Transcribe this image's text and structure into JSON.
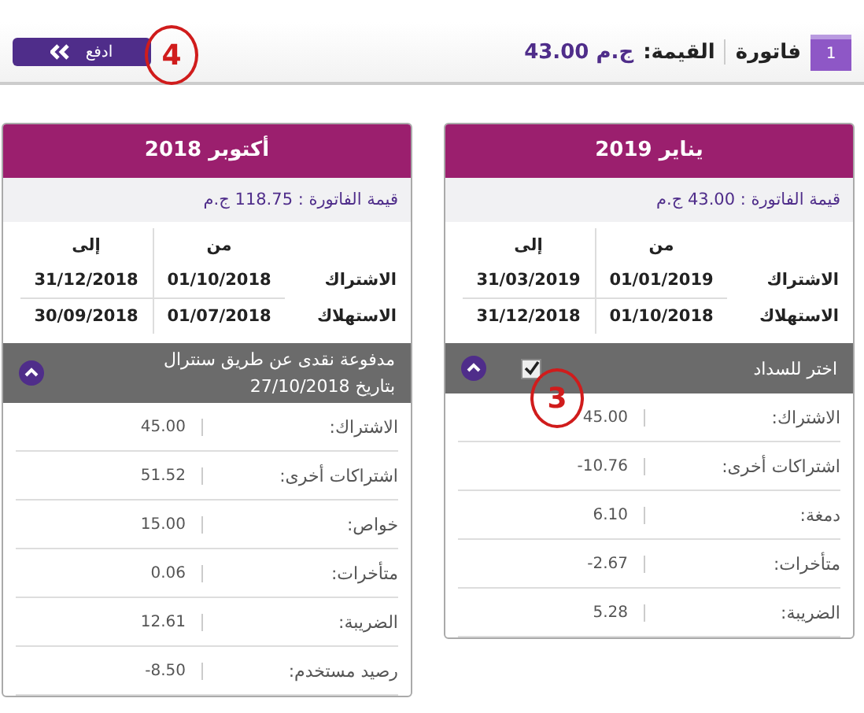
{
  "header": {
    "badge": "1",
    "title": "فاتورة",
    "value_label": "القيمة:",
    "value": "ج.م 43.00",
    "pay_button": "ادفع"
  },
  "cards": [
    {
      "month": "يناير 2019",
      "amount": "قيمة الفاتورة : 43.00 ج.م",
      "period_headers": [
        "من",
        "إلى"
      ],
      "periods": [
        {
          "label": "الاشتراك",
          "from": "01/01/2019",
          "to": "31/03/2019"
        },
        {
          "label": "الاستهلاك",
          "from": "01/10/2018",
          "to": "31/12/2018"
        }
      ],
      "status": {
        "kind": "select",
        "lines": [
          "اختر للسداد"
        ],
        "checked": true
      },
      "items": [
        {
          "label": "الاشتراك:",
          "value": "45.00"
        },
        {
          "label": "اشتراكات أخرى:",
          "value": "-10.76"
        },
        {
          "label": "دمغة:",
          "value": "6.10"
        },
        {
          "label": "متأخرات:",
          "value": "-2.67"
        },
        {
          "label": "الضريبة:",
          "value": "5.28"
        }
      ]
    },
    {
      "month": "أكتوبر 2018",
      "amount": "قيمة الفاتورة : 118.75 ج.م",
      "period_headers": [
        "من",
        "إلى"
      ],
      "periods": [
        {
          "label": "الاشتراك",
          "from": "01/10/2018",
          "to": "31/12/2018"
        },
        {
          "label": "الاستهلاك",
          "from": "01/07/2018",
          "to": "30/09/2018"
        }
      ],
      "status": {
        "kind": "paid",
        "lines": [
          "مدفوعة نقدى عن طريق سنترال",
          "بتاريخ 27/10/2018"
        ]
      },
      "items": [
        {
          "label": "الاشتراك:",
          "value": "45.00"
        },
        {
          "label": "اشتراكات أخرى:",
          "value": "51.52"
        },
        {
          "label": "خواص:",
          "value": "15.00"
        },
        {
          "label": "متأخرات:",
          "value": "0.06"
        },
        {
          "label": "الضريبة:",
          "value": "12.61"
        },
        {
          "label": "رصيد مستخدم:",
          "value": "-8.50"
        }
      ]
    }
  ],
  "annotations": [
    {
      "label": "4"
    },
    {
      "label": "3"
    }
  ]
}
